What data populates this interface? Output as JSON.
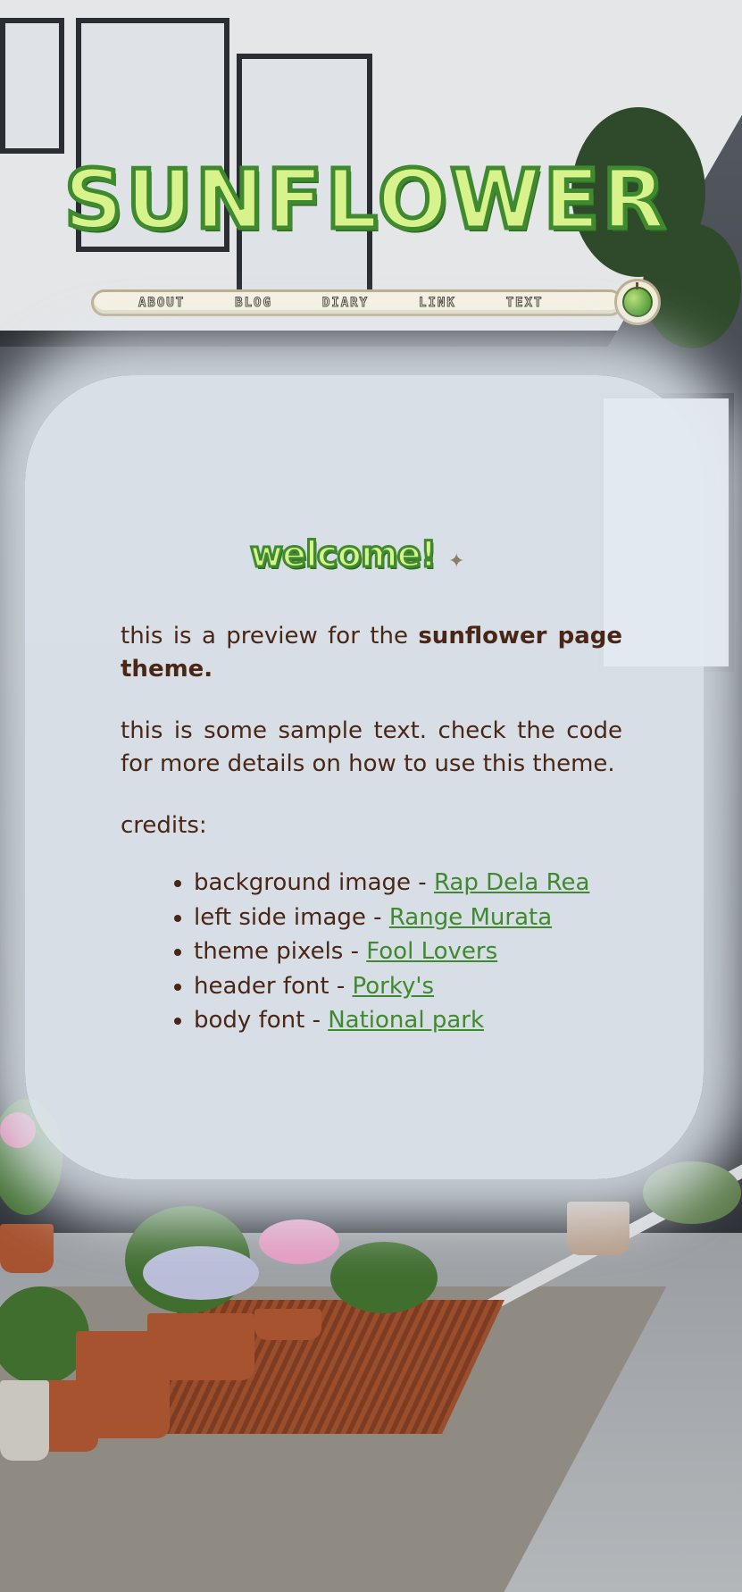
{
  "header": {
    "title": "SUNFLOWER"
  },
  "nav": {
    "items": [
      "ABOUT",
      "BLOG",
      "DIARY",
      "LINK",
      "TEXT"
    ],
    "badge_icon": "green-apple-icon"
  },
  "welcome": {
    "title": "welcome!",
    "icon": "sparkle-icon"
  },
  "body": {
    "intro_prefix": "this is a preview for the ",
    "intro_bold": "sunflower page theme.",
    "sample_text": "this is some sample text. check the code for more details on how to use this theme.",
    "credits_label": "credits:",
    "credits": [
      {
        "label": "background image - ",
        "link": "Rap Dela Rea"
      },
      {
        "label": "left side image - ",
        "link": "Range Murata"
      },
      {
        "label": "theme pixels - ",
        "link": "Fool Lovers"
      },
      {
        "label": "header font - ",
        "link": "Porky's"
      },
      {
        "label": "body font - ",
        "link": "National park"
      }
    ]
  },
  "colors": {
    "accent_green": "#3f8a2e",
    "logo_fill": "#d8f28c",
    "text_brown": "#4a2616",
    "panel": "#e2e9f0"
  }
}
